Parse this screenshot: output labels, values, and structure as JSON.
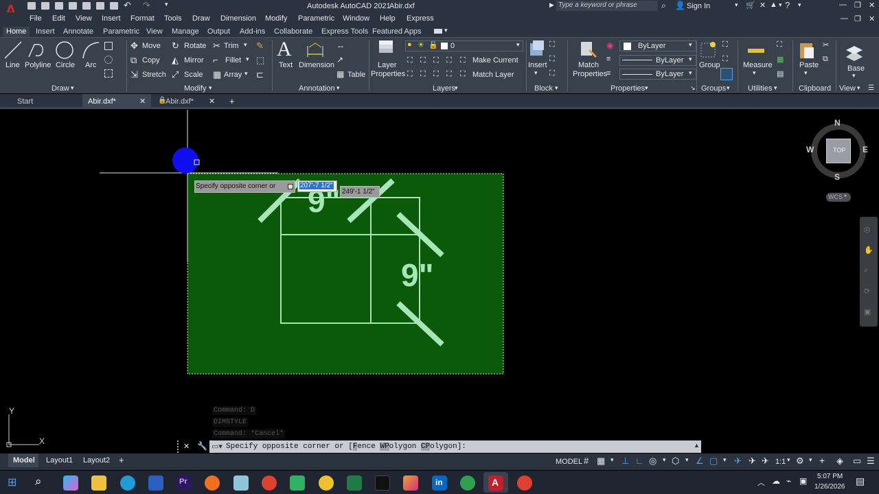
{
  "app": {
    "title": "Autodesk AutoCAD 2021",
    "filename": "Abir.dxf",
    "search_placeholder": "Type a keyword or phrase",
    "sign_in": "Sign In"
  },
  "menu": [
    "File",
    "Edit",
    "View",
    "Insert",
    "Format",
    "Tools",
    "Draw",
    "Dimension",
    "Modify",
    "Parametric",
    "Window",
    "Help",
    "Express"
  ],
  "ribbon_tabs": [
    "Home",
    "Insert",
    "Annotate",
    "Parametric",
    "View",
    "Manage",
    "Output",
    "Add-ins",
    "Collaborate",
    "Express Tools",
    "Featured Apps"
  ],
  "ribbon": {
    "draw": {
      "line": "Line",
      "polyline": "Polyline",
      "circle": "Circle",
      "arc": "Arc",
      "title": "Draw"
    },
    "modify": {
      "move": "Move",
      "rotate": "Rotate",
      "trim": "Trim",
      "copy": "Copy",
      "mirror": "Mirror",
      "fillet": "Fillet",
      "stretch": "Stretch",
      "scale": "Scale",
      "array": "Array",
      "title": "Modify"
    },
    "annotation": {
      "text": "Text",
      "dimension": "Dimension",
      "table": "Table",
      "title": "Annotation"
    },
    "layers": {
      "properties_l1": "Layer",
      "properties_l2": "Properties",
      "current_layer": "0",
      "make_current": "Make Current",
      "match_layer": "Match Layer",
      "title": "Layers"
    },
    "block": {
      "insert": "Insert",
      "title": "Block"
    },
    "properties": {
      "match_l1": "Match",
      "match_l2": "Properties",
      "color": "ByLayer",
      "linetype": "ByLayer",
      "lineweight": "ByLayer",
      "title": "Properties"
    },
    "groups": {
      "group": "Group",
      "title": "Groups"
    },
    "utilities": {
      "measure": "Measure",
      "title": "Utilities"
    },
    "clipboard": {
      "paste": "Paste",
      "title": "Clipboard"
    },
    "view": {
      "base": "Base",
      "title": "View"
    }
  },
  "doc_tabs": [
    {
      "label": "Start"
    },
    {
      "label": "Abir.dxf*"
    },
    {
      "label": "Abir.dxf*"
    }
  ],
  "viewcube": {
    "n": "N",
    "s": "S",
    "e": "E",
    "w": "W",
    "face": "TOP",
    "wcs": "WCS"
  },
  "drawing": {
    "dim1": "9\"",
    "dim2": "9\""
  },
  "tooltip": {
    "prompt": "Specify opposite corner or",
    "input1": "207'-7 1/2\"",
    "input2": "249'-1 1/2\""
  },
  "command_history": [
    "Command: D",
    "DIMSTYLE",
    "Command: *Cancel*"
  ],
  "command_line": {
    "prompt": "Specify opposite corner or [",
    "opt1_hl": "F",
    "opt1": "ence ",
    "opt2_hl": "WP",
    "opt2": "olygon ",
    "opt3_hl": "CP",
    "opt3": "olygon",
    "end": "]:"
  },
  "ucs": {
    "x": "X",
    "y": "Y"
  },
  "layout_tabs": [
    "Model",
    "Layout1",
    "Layout2"
  ],
  "status": {
    "model": "MODEL",
    "scale": "1:1"
  },
  "clock": {
    "time": "5:07 PM",
    "date": "1/26/2026"
  }
}
